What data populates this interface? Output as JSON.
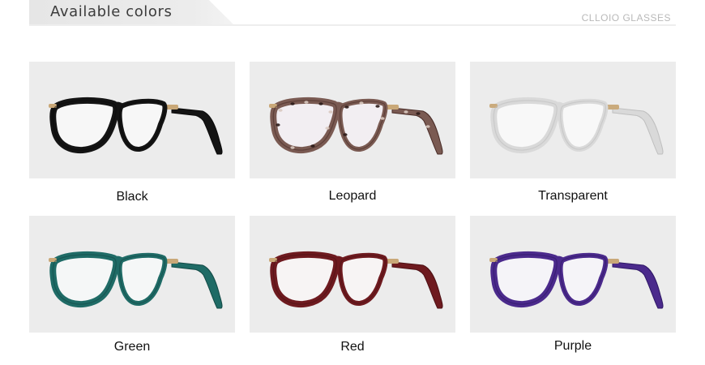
{
  "header": {
    "title": "Available colors",
    "brand": "CLLOIO GLASSES"
  },
  "products": [
    {
      "label": "Black",
      "frame_color": "#141414",
      "rim_color": "#0a0a0a",
      "lens_tint": "#f7f7f7",
      "pattern": "solid"
    },
    {
      "label": "Leopard",
      "frame_color": "#7a5a52",
      "rim_color": "#4a2d28",
      "lens_tint": "#f2eef2",
      "pattern": "leopard"
    },
    {
      "label": "Transparent",
      "frame_color": "#d9d9d9",
      "rim_color": "#bdbdbd",
      "lens_tint": "#f9f9f9",
      "pattern": "clear"
    },
    {
      "label": "Green",
      "frame_color": "#1f6b66",
      "rim_color": "#134a46",
      "lens_tint": "#f5f7f7",
      "pattern": "solid"
    },
    {
      "label": "Red",
      "frame_color": "#6e1a1f",
      "rim_color": "#4d1014",
      "lens_tint": "#f7f4f4",
      "pattern": "solid"
    },
    {
      "label": "Purple",
      "frame_color": "#4b2a8c",
      "rim_color": "#2f1866",
      "lens_tint": "#f5f4f8",
      "pattern": "solid"
    }
  ],
  "hinge_color": "#c9a878"
}
